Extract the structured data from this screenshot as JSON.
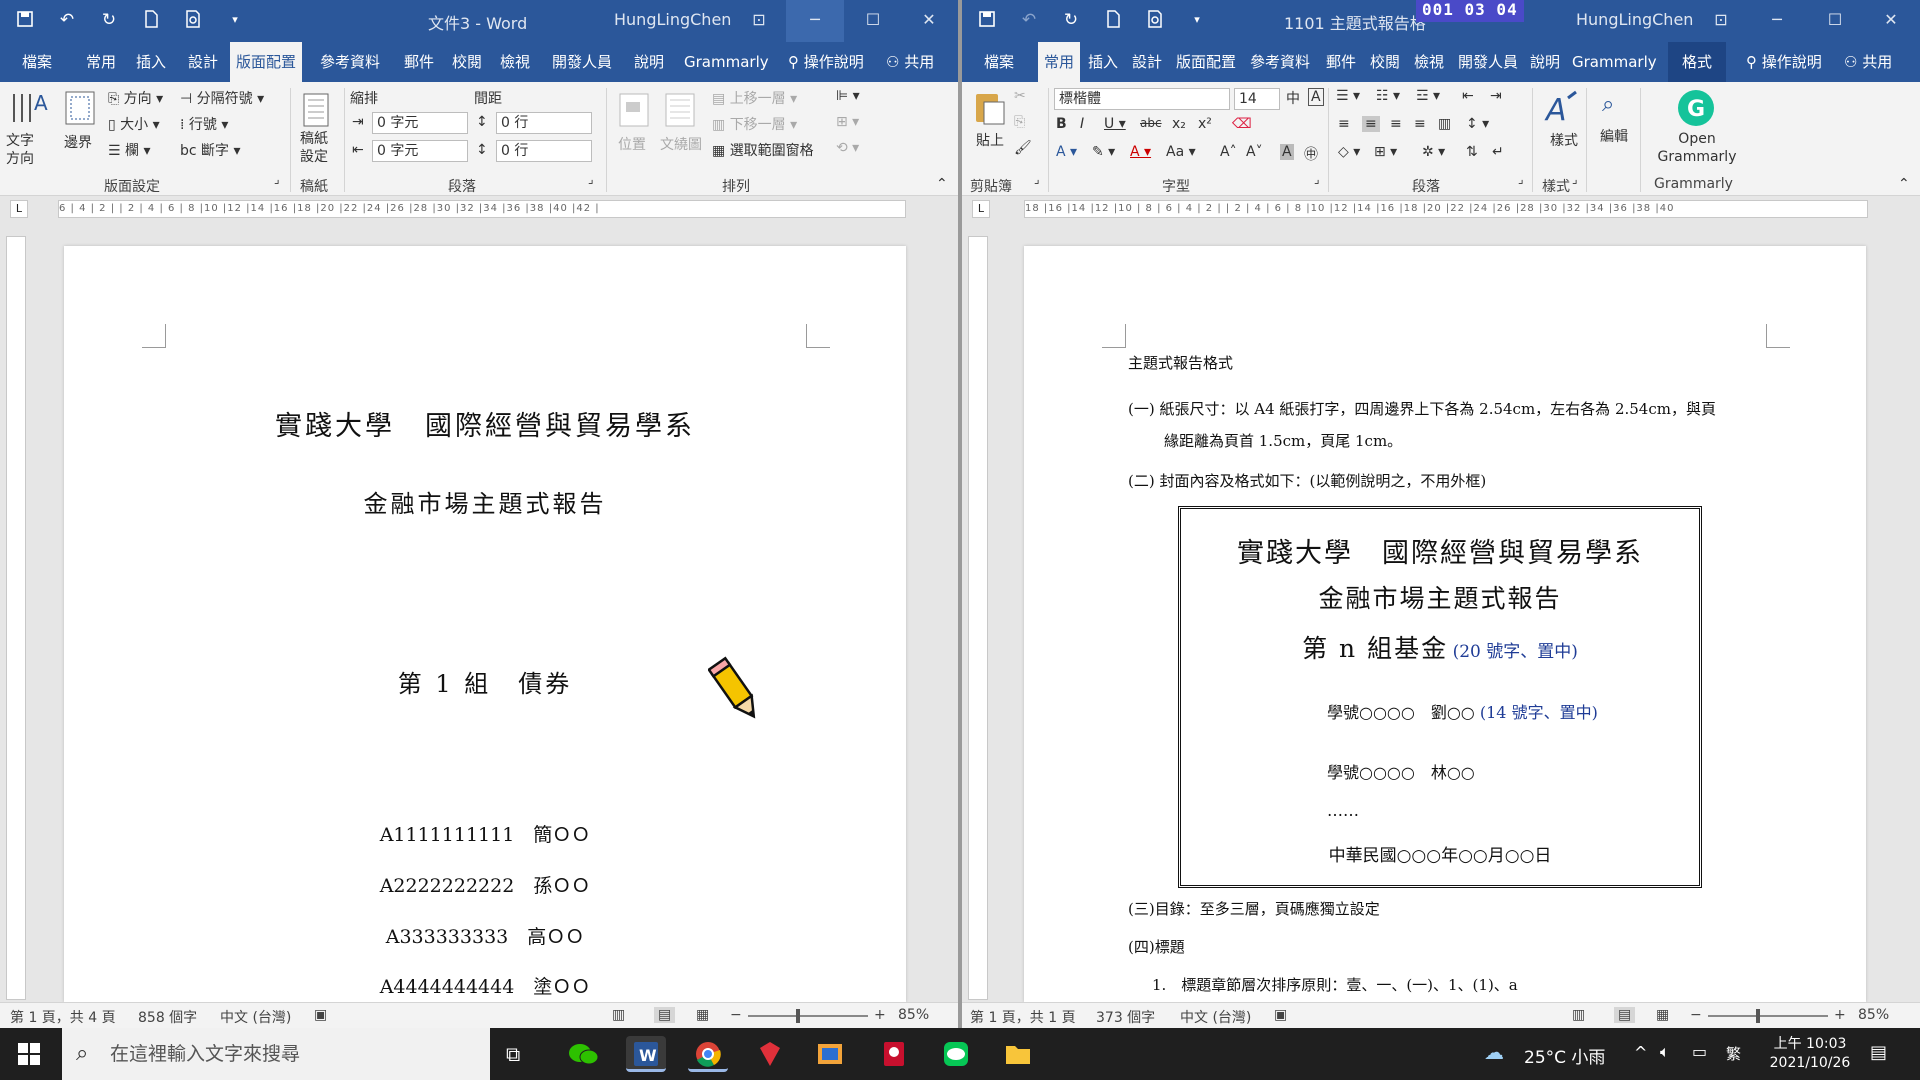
{
  "left": {
    "title": "文件3 - Word",
    "user": "HungLingChen",
    "tabs": [
      "檔案",
      "常用",
      "插入",
      "設計",
      "版面配置",
      "參考資料",
      "郵件",
      "校閱",
      "檢視",
      "開發人員",
      "說明",
      "Grammarly",
      "操作說明",
      "共用"
    ],
    "ribbon": {
      "text_direction": "文字方向",
      "margins": "邊界",
      "orientation": "方向",
      "size": "大小",
      "columns": "欄",
      "breaks": "分隔符號",
      "line_numbers": "行號",
      "hyphenation": "斷字",
      "manuscript": "稿紙設定",
      "indent_label": "縮排",
      "spacing_label": "間距",
      "indent_left": "0 字元",
      "indent_right": "0 字元",
      "spacing_before": "0 行",
      "spacing_after": "0 行",
      "position": "位置",
      "wrap_text": "文繞圖",
      "bring_forward": "上移一層",
      "send_backward": "下移一層",
      "selection_pane": "選取範圍窗格",
      "group_page_setup": "版面設定",
      "group_manuscript": "稿紙",
      "group_paragraph": "段落",
      "group_arrange": "排列"
    },
    "ruler": "6 | 4 | 2 |   | 2 | 4 | 6 | 8 |10 |12 |14 |16 |18 |20 |22 |24 |26 |28 |30 |32 |34 |36 |38 |40 |42 |",
    "doc": {
      "line1": "實踐大學　國際經營與貿易學系",
      "line2": "金融市場主題式報告",
      "line3": "第 1 組　債券",
      "members": [
        "A1111111111　簡ＯＯ",
        "A2222222222　孫ＯＯ",
        "A333333333　高ＯＯ",
        "A4444444444　塗ＯＯ"
      ]
    },
    "status": {
      "page": "第 1 頁，共 4 頁",
      "words": "858 個字",
      "lang": "中文 (台灣)",
      "zoom": "85%"
    }
  },
  "right": {
    "title": "1101 主題式報告格",
    "timestamp_overlay": "001 03 04",
    "user": "HungLingChen",
    "tabs": [
      "檔案",
      "常用",
      "插入",
      "設計",
      "版面配置",
      "參考資料",
      "郵件",
      "校閱",
      "檢視",
      "開發人員",
      "說明",
      "Grammarly",
      "格式",
      "操作說明",
      "共用"
    ],
    "ribbon": {
      "paste": "貼上",
      "font_name": "標楷體",
      "font_size": "14",
      "styles": "樣式",
      "editing": "編輯",
      "open_grammarly": "Open Grammarly",
      "group_clipboard": "剪貼簿",
      "group_font": "字型",
      "group_paragraph": "段落",
      "group_styles": "樣式",
      "group_grammarly": "Grammarly"
    },
    "ruler": "18 |16 |14 |12 |10 | 8 | 6 | 4 | 2 |   | 2 | 4 | 6 | 8 |10 |12 |14 |16 |18 |20 |22 |24 |26 |28 |30 |32 |34 |36 |38 |40",
    "doc": {
      "heading": "主題式報告格式",
      "item1a": "(一) 紙張尺寸：以 A4 紙張打字，四周邊界上下各為 2.54cm，左右各為 2.54cm，與頁",
      "item1b": "緣距離為頁首 1.5cm，頁尾 1cm。",
      "item2": "(二) 封面內容及格式如下：(以範例說明之，不用外框)",
      "box": {
        "line1": "實踐大學　國際經營與貿易學系",
        "line2": "金融市場主題式報告",
        "line3": "第 n 組基金",
        "line3_note": "(20 號字、置中)",
        "student1": "學號○○○○　劉○○",
        "student1_note": "(14 號字、置中)",
        "student2": "學號○○○○　林○○",
        "ellipsis": "……",
        "date": "中華民國○○○年○○月○○日"
      },
      "item3": "(三)目錄：至多三層，頁碼應獨立設定",
      "item4": "(四)標題",
      "item4_1": "1.　標題章節層次排序原則：壹、一、(一)、1、(1)、a"
    },
    "status": {
      "page": "第 1 頁，共 1 頁",
      "words": "373 個字",
      "lang": "中文 (台灣)",
      "zoom": "85%"
    }
  },
  "taskbar": {
    "search_placeholder": "在這裡輸入文字來搜尋",
    "weather": "25°C 小雨",
    "ime": "繁",
    "time": "上午 10:03",
    "date": "2021/10/26"
  }
}
